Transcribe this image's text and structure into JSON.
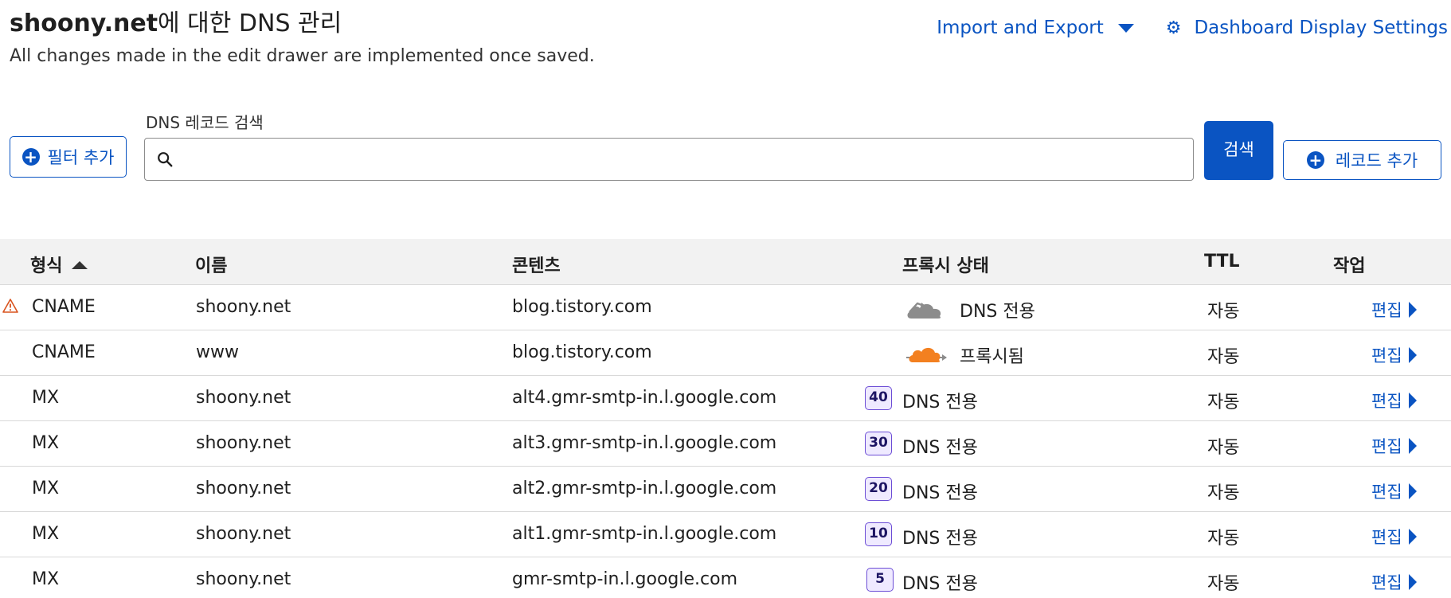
{
  "header": {
    "title_domain": "shoony.net",
    "title_suffix": "에 대한 DNS 관리",
    "subtitle": "All changes made in the edit drawer are implemented once saved.",
    "import_export": "Import and Export",
    "dashboard_settings": "Dashboard Display Settings"
  },
  "toolbar": {
    "add_filter": "필터 추가",
    "search_label": "DNS 레코드 검색",
    "search_value": "",
    "search_button": "검색",
    "add_record": "레코드 추가"
  },
  "table": {
    "columns": {
      "type": "형식",
      "name": "이름",
      "content": "콘텐츠",
      "proxy": "프록시 상태",
      "ttl": "TTL",
      "action": "작업"
    },
    "rows": [
      {
        "type": "CNAME",
        "name": "shoony.net",
        "content": "blog.tistory.com",
        "priority": "",
        "proxy": "DNS 전용",
        "proxy_icon": "cloud-dns-only-icon",
        "ttl": "자동",
        "edit": "편집",
        "warning": true
      },
      {
        "type": "CNAME",
        "name": "www",
        "content": "blog.tistory.com",
        "priority": "",
        "proxy": "프록시됨",
        "proxy_icon": "cloud-proxied-icon",
        "ttl": "자동",
        "edit": "편집",
        "warning": false
      },
      {
        "type": "MX",
        "name": "shoony.net",
        "content": "alt4.gmr-smtp-in.l.google.com",
        "priority": "40",
        "proxy": "DNS 전용",
        "ttl": "자동",
        "edit": "편집",
        "warning": false
      },
      {
        "type": "MX",
        "name": "shoony.net",
        "content": "alt3.gmr-smtp-in.l.google.com",
        "priority": "30",
        "proxy": "DNS 전용",
        "ttl": "자동",
        "edit": "편집",
        "warning": false
      },
      {
        "type": "MX",
        "name": "shoony.net",
        "content": "alt2.gmr-smtp-in.l.google.com",
        "priority": "20",
        "proxy": "DNS 전용",
        "ttl": "자동",
        "edit": "편집",
        "warning": false
      },
      {
        "type": "MX",
        "name": "shoony.net",
        "content": "alt1.gmr-smtp-in.l.google.com",
        "priority": "10",
        "proxy": "DNS 전용",
        "ttl": "자동",
        "edit": "편집",
        "warning": false
      },
      {
        "type": "MX",
        "name": "shoony.net",
        "content": "gmr-smtp-in.l.google.com",
        "priority": "5",
        "proxy": "DNS 전용",
        "ttl": "자동",
        "edit": "편집",
        "warning": false
      }
    ]
  },
  "colors": {
    "accent": "#0a54c2",
    "proxied_orange": "#f38020",
    "dns_only_gray": "#8c8c8c",
    "warning": "#d9531e"
  }
}
